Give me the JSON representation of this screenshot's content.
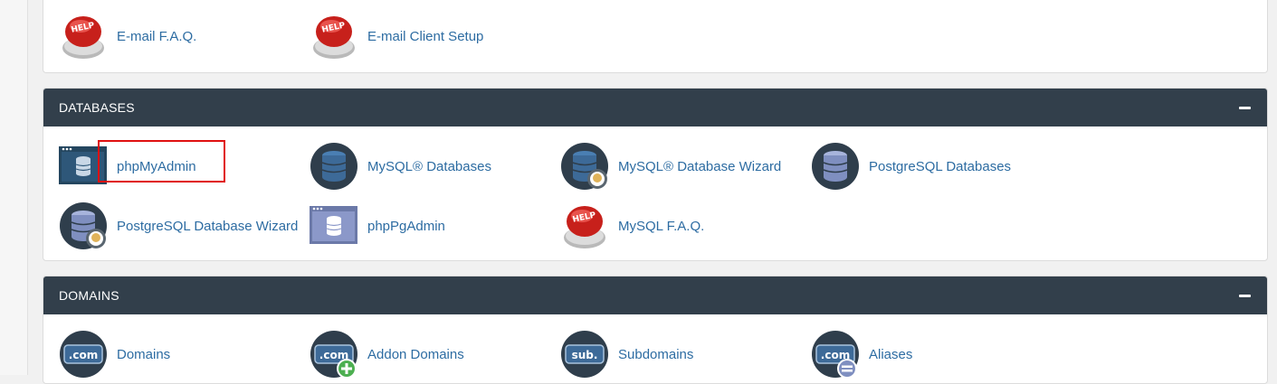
{
  "email_section": {
    "items": [
      {
        "label": "E-mail F.A.Q.",
        "icon": "help-button-icon"
      },
      {
        "label": "E-mail Client Setup",
        "icon": "help-button-icon"
      }
    ]
  },
  "databases": {
    "title": "DATABASES",
    "items": [
      {
        "label": "phpMyAdmin",
        "icon": "phpmyadmin-icon"
      },
      {
        "label": "MySQL® Databases",
        "icon": "mysql-database-icon"
      },
      {
        "label": "MySQL® Database Wizard",
        "icon": "mysql-wizard-icon"
      },
      {
        "label": "PostgreSQL Databases",
        "icon": "postgresql-database-icon"
      },
      {
        "label": "PostgreSQL Database Wizard",
        "icon": "postgresql-wizard-icon"
      },
      {
        "label": "phpPgAdmin",
        "icon": "phppgadmin-icon"
      },
      {
        "label": "MySQL F.A.Q.",
        "icon": "help-button-icon"
      }
    ]
  },
  "domains": {
    "title": "DOMAINS",
    "items": [
      {
        "label": "Domains",
        "icon_text": ".com",
        "icon": "domains-icon"
      },
      {
        "label": "Addon Domains",
        "icon_text": ".com",
        "icon": "addon-domains-icon"
      },
      {
        "label": "Subdomains",
        "icon_text": "sub.",
        "icon": "subdomains-icon"
      },
      {
        "label": "Aliases",
        "icon_text": ".com",
        "icon": "aliases-icon"
      }
    ]
  },
  "help_icon_text": "HELP",
  "colors": {
    "header_bg": "#323f4b",
    "link": "#2d6ca2",
    "db_dark": "#2f3e4c",
    "db_blue": "#3d6a98",
    "pg_blue": "#7f8fc0",
    "highlight": "#e01010"
  }
}
